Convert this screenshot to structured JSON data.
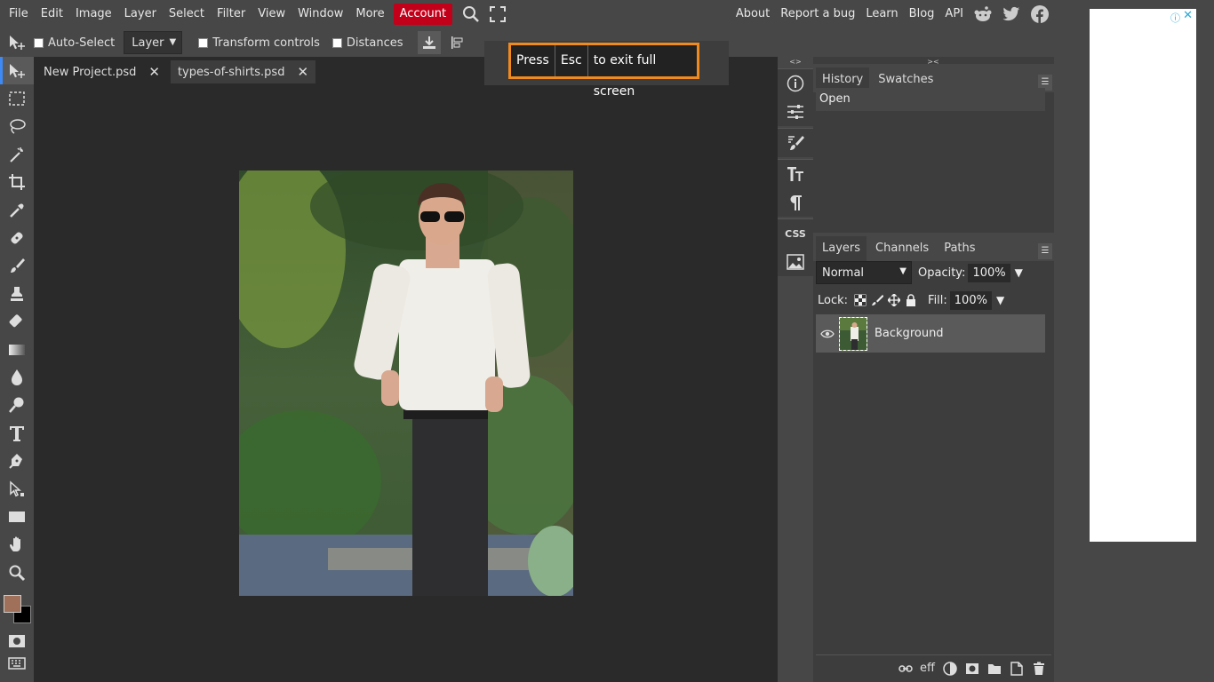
{
  "menu": {
    "items": [
      "File",
      "Edit",
      "Image",
      "Layer",
      "Select",
      "Filter",
      "View",
      "Window",
      "More"
    ],
    "account": "Account",
    "right_links": [
      "About",
      "Report a bug",
      "Learn",
      "Blog",
      "API"
    ],
    "social_icons": [
      "reddit-icon",
      "twitter-icon",
      "facebook-icon"
    ]
  },
  "options": {
    "auto_select": "Auto-Select",
    "auto_select_target": "Layer",
    "transform_controls": "Transform controls",
    "distances": "Distances"
  },
  "fullscreen_notice": {
    "press": "Press",
    "key": "Esc",
    "message": "to exit full screen"
  },
  "tabs": [
    {
      "label": "New Project.psd"
    },
    {
      "label": "types-of-shirts.psd"
    }
  ],
  "close_glyph": "✕",
  "strip": {
    "arrows_left": "<>",
    "arrows_right": "><",
    "css_label": "CSS"
  },
  "history": {
    "tabs": [
      "History",
      "Swatches"
    ],
    "items": [
      "Open"
    ]
  },
  "layers": {
    "tabs": [
      "Layers",
      "Channels",
      "Paths"
    ],
    "blend_mode": "Normal",
    "opacity_label": "Opacity:",
    "opacity_value": "100%",
    "lock_label": "Lock:",
    "fill_label": "Fill:",
    "fill_value": "100%",
    "items": [
      {
        "name": "Background"
      }
    ],
    "footer_eff": "eff"
  },
  "colors": {
    "foreground": "#a0705a",
    "background": "#000000",
    "accent_account": "#c2001a",
    "fullscreen_border": "#f08a1e"
  }
}
